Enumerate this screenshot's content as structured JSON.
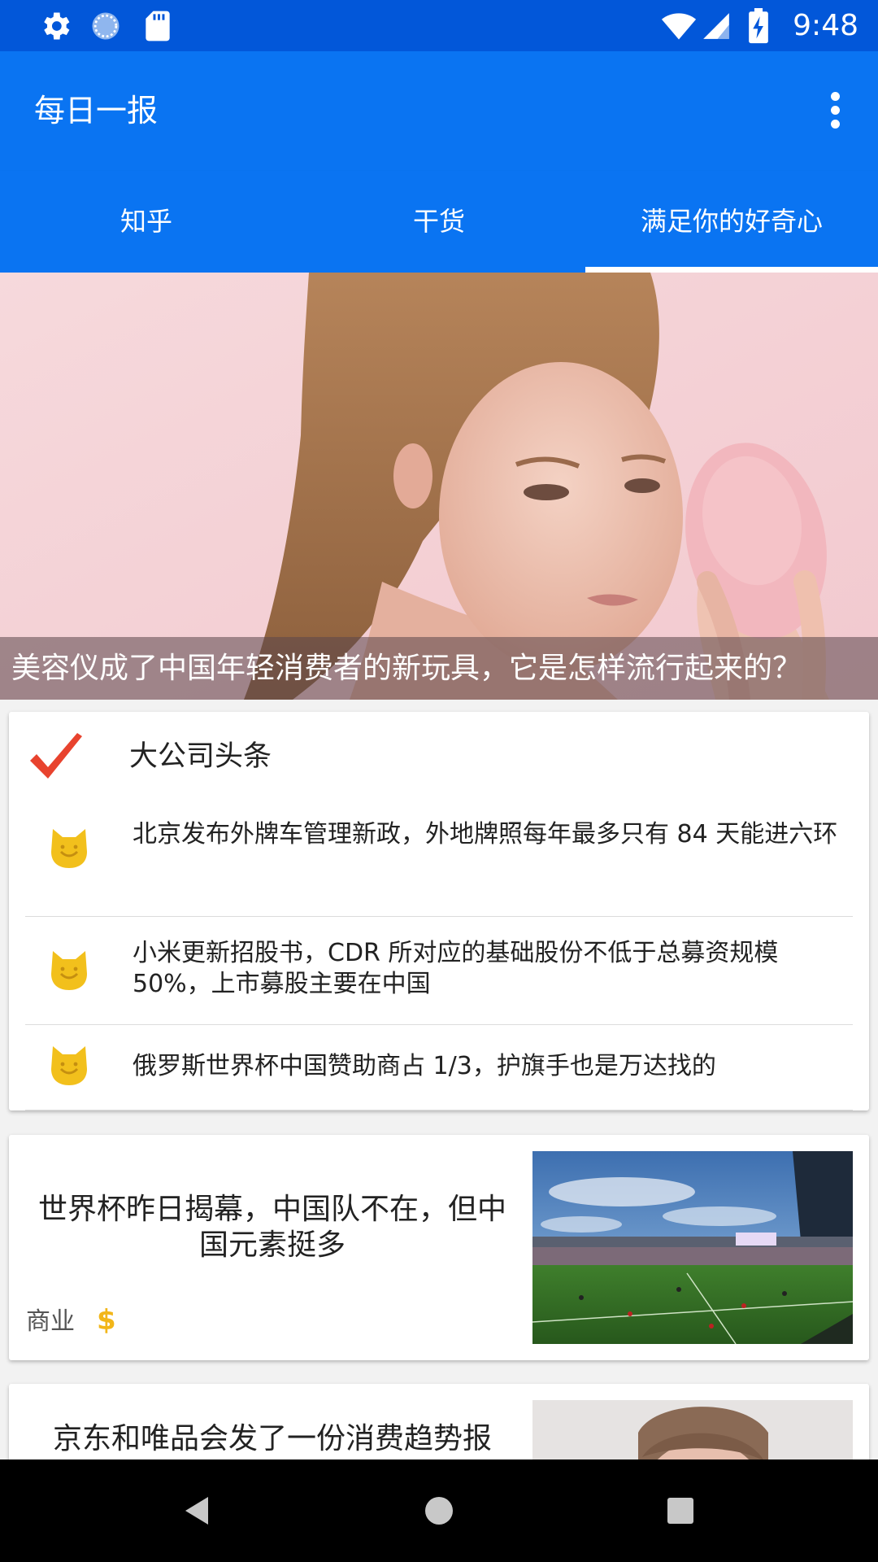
{
  "status_bar": {
    "time": "9:48",
    "icons": [
      "settings-icon",
      "sync-icon",
      "sd-card-icon",
      "wifi-icon",
      "cellular-signal-icon",
      "battery-charging-icon"
    ]
  },
  "app_bar": {
    "title": "每日一报",
    "menu_icon": "more-vert-icon"
  },
  "tabs": [
    {
      "label": "知乎",
      "selected": false
    },
    {
      "label": "干货",
      "selected": false
    },
    {
      "label": "满足你的好奇心",
      "selected": true
    }
  ],
  "hero": {
    "caption": "美容仪成了中国年轻消费者的新玩具，它是怎样流行起来的？"
  },
  "headlines_card": {
    "title": "大公司头条",
    "title_icon": "checkmark-icon",
    "items": [
      {
        "text": "北京发布外牌车管理新政，外地牌照每年最多只有 84 天能进六环",
        "icon": "cat-icon"
      },
      {
        "text": "小米更新招股书，CDR 所对应的基础股份不低于总募资规模 50%，上市募股主要在中国",
        "icon": "cat-icon"
      },
      {
        "text": "俄罗斯世界杯中国赞助商占 1/3，护旗手也是万达找的",
        "icon": "cat-icon"
      }
    ]
  },
  "news_cards": [
    {
      "title": "世界杯昨日揭幕，中国队不在，但中国元素挺多",
      "tag": "商业",
      "tag_icon": "dollar-icon",
      "image": "stadium-photo"
    },
    {
      "title": "京东和唯品会发了一份消费趋势报",
      "image": "man-portrait-photo"
    }
  ],
  "colors": {
    "status_bar": "#0257d9",
    "app_bar": "#0a74f2",
    "accent_red": "#e8432e",
    "cat_yellow": "#f2c01c",
    "dollar_yellow": "#f2b619"
  },
  "nav_bar": {
    "buttons": [
      "back-icon",
      "home-icon",
      "recents-icon"
    ]
  }
}
